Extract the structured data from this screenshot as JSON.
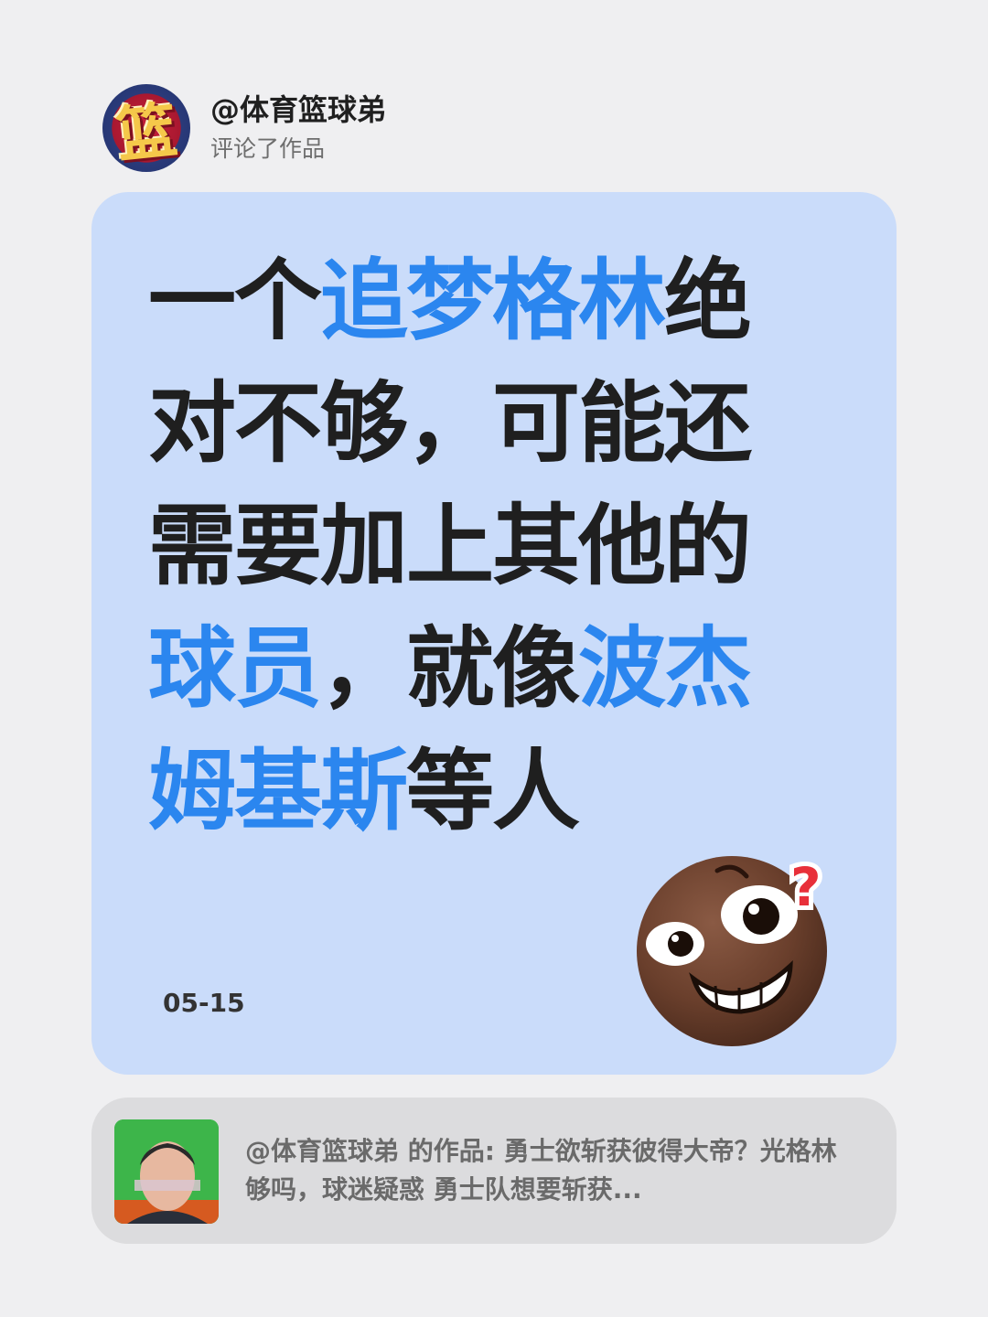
{
  "header": {
    "avatar_char": "篮",
    "username": "@体育篮球弟",
    "action": "评论了作品"
  },
  "card": {
    "comment_parts": {
      "p1": "一个",
      "p2": "追梦格林",
      "p3": "绝对不够，可能还需要加上其他的",
      "p4": "球员",
      "p5": "，就像",
      "p6": "波杰姆基斯",
      "p7": "等人"
    },
    "date": "05-15",
    "emoji": "confused-grin-emoji"
  },
  "quote": {
    "text": "@体育篮球弟 的作品: 勇士欲斩获彼得大帝？光格林够吗，球迷疑惑 勇士队想要斩获..."
  },
  "colors": {
    "background": "#efeff1",
    "card": "#cadcfa",
    "highlight": "#2b86ef",
    "text": "#1f1f1f",
    "quote_bg": "#dcdcde"
  }
}
